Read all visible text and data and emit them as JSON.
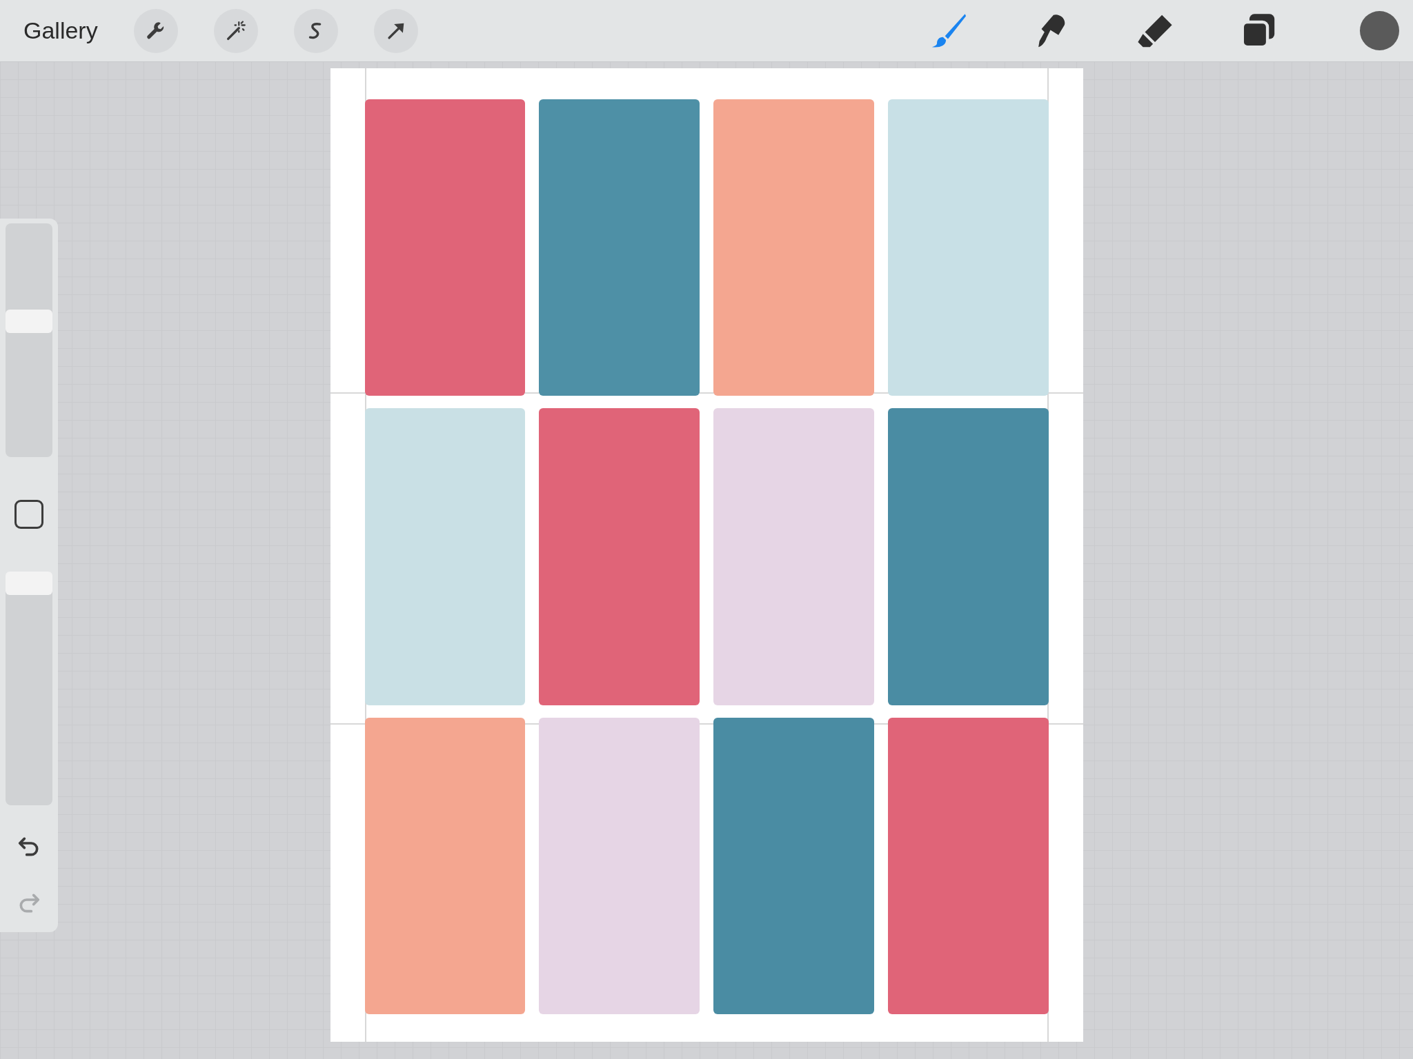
{
  "toolbar": {
    "gallery": "Gallery",
    "left_tools": [
      {
        "kind": "wrench"
      },
      {
        "kind": "wand"
      },
      {
        "kind": "selection"
      },
      {
        "kind": "transform"
      }
    ],
    "right_tools": [
      {
        "kind": "brush",
        "selected": true
      },
      {
        "kind": "smudge",
        "selected": false
      },
      {
        "kind": "eraser",
        "selected": false
      },
      {
        "kind": "layers",
        "selected": false
      }
    ]
  },
  "sidebar": {
    "size_slider": {
      "level": 0.59
    },
    "opacity_slider": {
      "level": 1
    },
    "undo": {
      "disabled": false
    },
    "redo": {
      "disabled": true
    }
  },
  "canvas": {
    "swatches": [
      {
        "color": "#e06478"
      },
      {
        "color": "#4e90a6"
      },
      {
        "color": "#f4a690"
      },
      {
        "color": "#c8e0e6"
      },
      {
        "color": "#c9e0e5"
      },
      {
        "color": "#e06478"
      },
      {
        "color": "#e6d5e5"
      },
      {
        "color": "#4a8ca3"
      },
      {
        "color": "#f4a690"
      },
      {
        "color": "#e6d5e5"
      },
      {
        "color": "#4a8ca3"
      },
      {
        "color": "#e06478"
      }
    ]
  }
}
